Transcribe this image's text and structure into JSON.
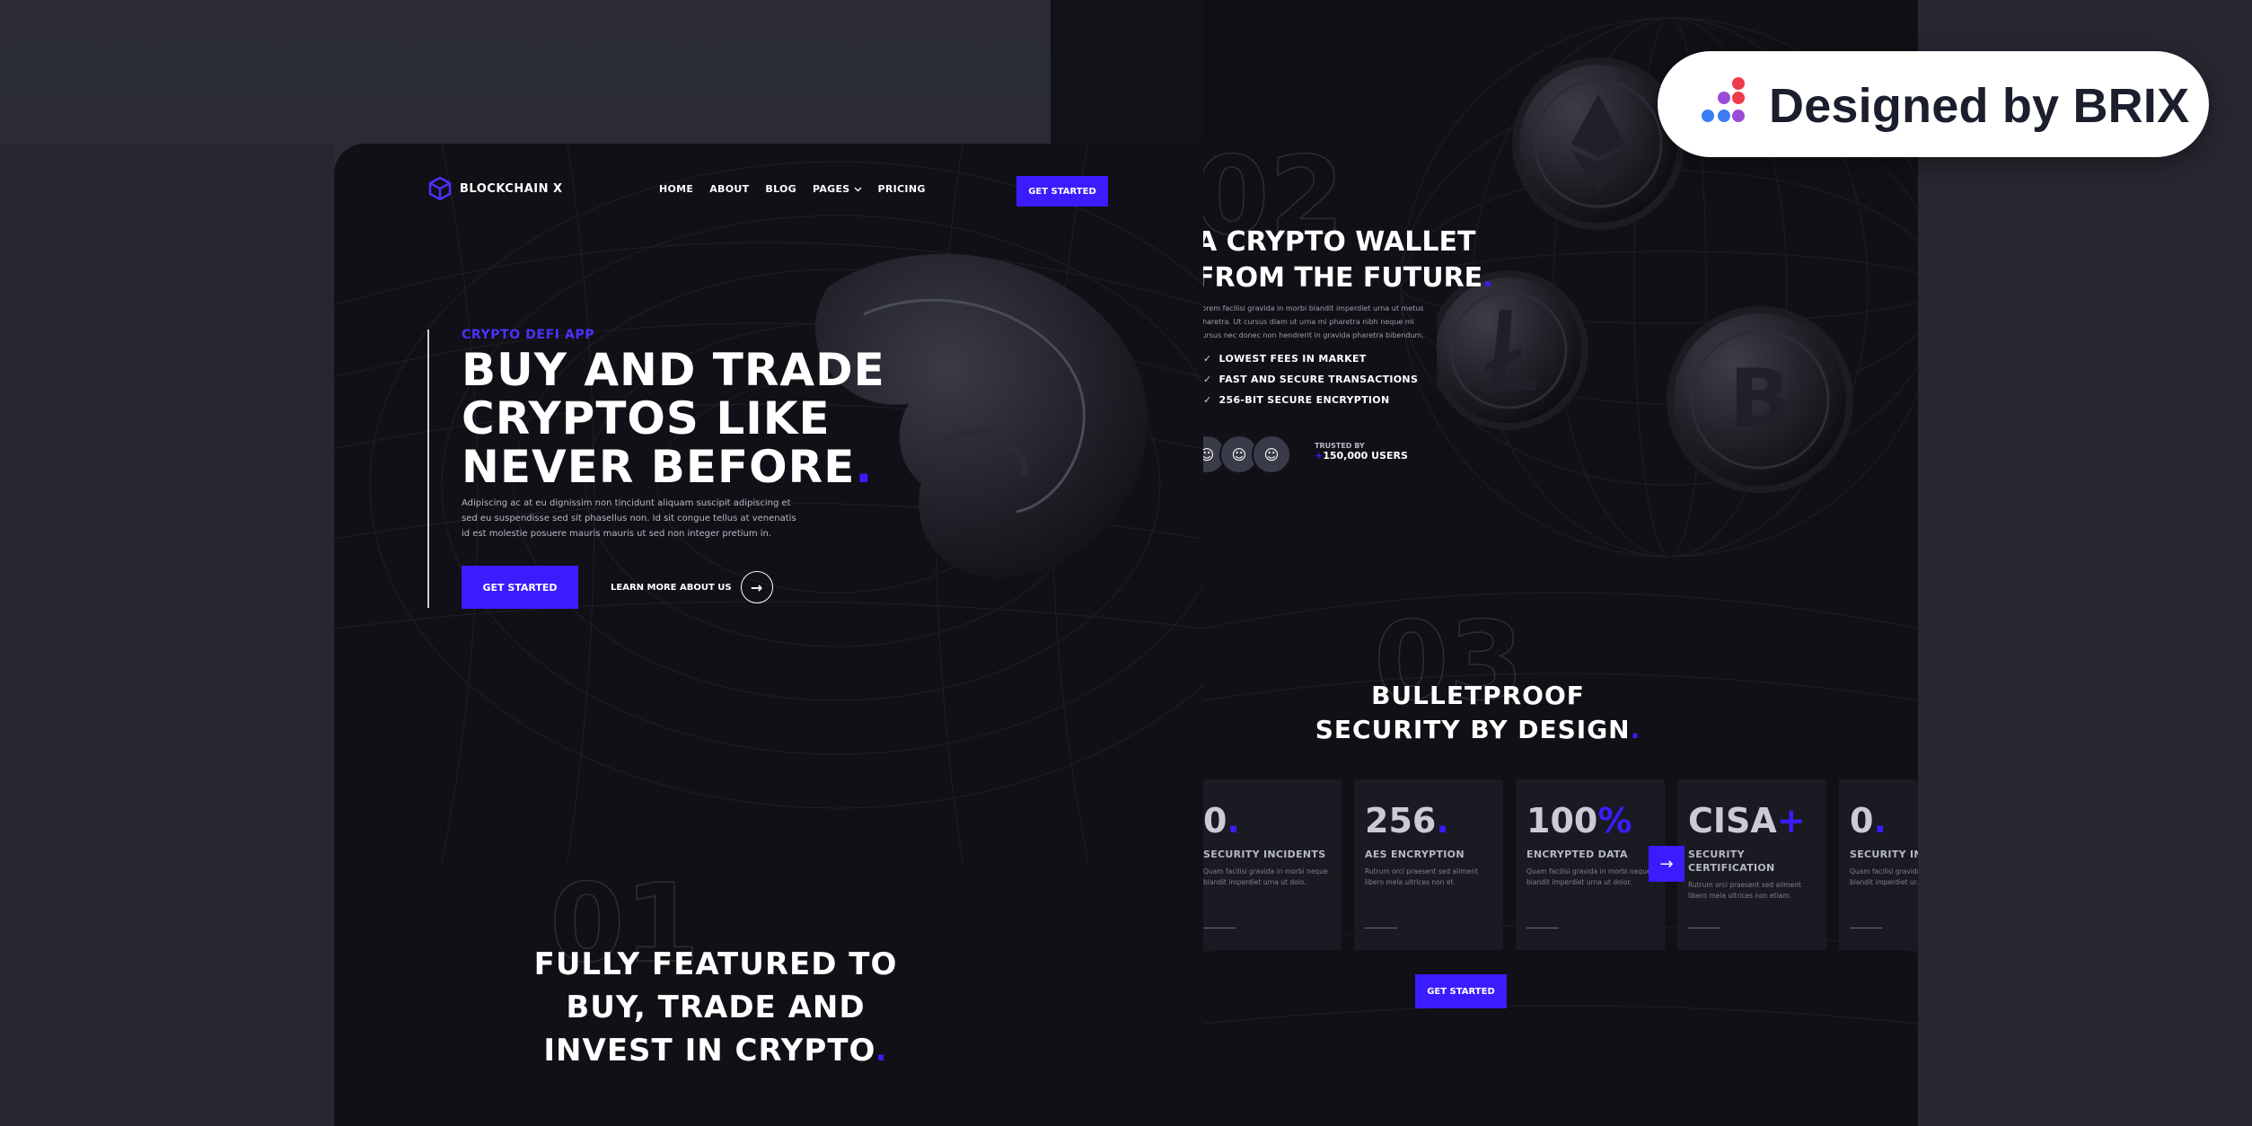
{
  "badge": {
    "text": "Designed by BRIX"
  },
  "nav": {
    "logo": "BLOCKCHAIN X",
    "links": [
      "HOME",
      "ABOUT",
      "BLOG",
      "PAGES",
      "PRICING"
    ],
    "cta": "GET STARTED"
  },
  "hero": {
    "eyebrow": "CRYPTO  DEFI APP",
    "title_lines": [
      "BUY AND TRADE",
      "CRYPTOS LIKE",
      "NEVER BEFORE"
    ],
    "body": "Adipiscing ac at eu dignissim non tincidunt aliquam suscipit adipiscing et sed eu suspendisse sed sit phasellus non. Id sit congue tellus at venenatis id est molestie posuere mauris mauris ut sed non integer pretium in.",
    "primary_button": "GET STARTED",
    "secondary_link": "LEARN MORE ABOUT US"
  },
  "section1": {
    "number": "01",
    "title_lines": [
      "FULLY FEATURED TO",
      "BUY, TRADE AND",
      "INVEST IN CRYPTO"
    ]
  },
  "section2": {
    "number": "02",
    "title_lines": [
      "A CRYPTO WALLET",
      "FROM THE FUTURE"
    ],
    "body": "Lorem facilisi gravida in morbi blandit imperdiet urna ut metus pharetra. Ut cursus diam ut urna mi pharetra nibh neque mi cursus nec donec non hendrerit in gravida pharetra bibendum.",
    "features": [
      "LOWEST FEES IN MARKET",
      "FAST AND SECURE TRANSACTIONS",
      "256-BIT SECURE ENCRYPTION"
    ],
    "trusted_label": "TRUSTED BY",
    "trusted_value": "150,000 USERS",
    "trusted_plus": "+"
  },
  "section3": {
    "number": "03",
    "title_lines": [
      "BULLETPROOF",
      "SECURITY BY DESIGN"
    ],
    "stats": [
      {
        "value": "0",
        "accent": ".",
        "label": "SECURITY INCIDENTS",
        "desc": "Quam facilisi gravida in morbi neque blandit imperdiet urna ut dolo."
      },
      {
        "value": "256",
        "accent": ".",
        "label": "AES ENCRYPTION",
        "desc": "Rutrum orci praesent sed aliment libero mela ultrices non et."
      },
      {
        "value": "100",
        "accent": "%",
        "label": "ENCRYPTED DATA",
        "desc": "Quam facilisi gravida in morbi neque blandit imperdiet urna ut dolor."
      },
      {
        "value": "CISA",
        "accent": "+",
        "label": "SECURITY CERTIFICATION",
        "desc": "Rutrum orci praesent sed aliment libero mela ultrices non etiam."
      },
      {
        "value": "0",
        "accent": ".",
        "label": "SECURITY INCIDENTS",
        "desc": "Quam facilisi gravida in morbi neque blandit imperdiet ur."
      }
    ],
    "button": "GET STARTED"
  },
  "colors": {
    "accent": "#3b1cff",
    "bg": "#101016",
    "frame": "#26272f"
  }
}
